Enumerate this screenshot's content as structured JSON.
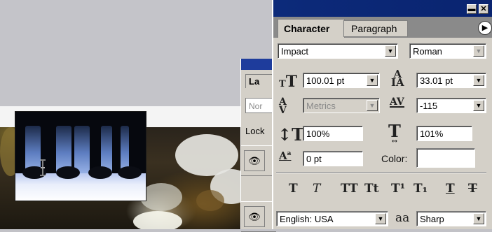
{
  "character_panel": {
    "tabs": [
      {
        "label": "Character",
        "active": true
      },
      {
        "label": "Paragraph",
        "active": false
      }
    ],
    "font_family": "Impact",
    "font_style": "Roman",
    "font_size": "100.01 pt",
    "leading": "33.01 pt",
    "kerning": "Metrics",
    "tracking": "-115",
    "vertical_scale": "100%",
    "horizontal_scale": "101%",
    "baseline_shift": "0 pt",
    "color_label": "Color:",
    "color_value": "#ffffff",
    "style_buttons": [
      "T",
      "T",
      "TT",
      "Tt",
      "T¹",
      "T₁",
      "T",
      "T"
    ],
    "language": "English: USA",
    "antialias_icon": "aa",
    "antialias": "Sharp",
    "title_buttons": [
      "minimize-icon",
      "close-icon"
    ],
    "icons": {
      "font_size": "font-size-icon",
      "leading": "leading-icon",
      "kerning": "kerning-icon",
      "tracking": "tracking-icon",
      "vertical_scale": "vertical-scale-icon",
      "horizontal_scale": "horizontal-scale-icon",
      "baseline_shift": "baseline-shift-icon"
    }
  },
  "layers_panel": {
    "tab_label": "La",
    "blend_mode": "Nor",
    "lock_label": "Lock"
  },
  "colors": {
    "titlebar": "#0c2a7a",
    "panel_bg": "#d4d0c8",
    "workspace": "#c4c4c9"
  }
}
